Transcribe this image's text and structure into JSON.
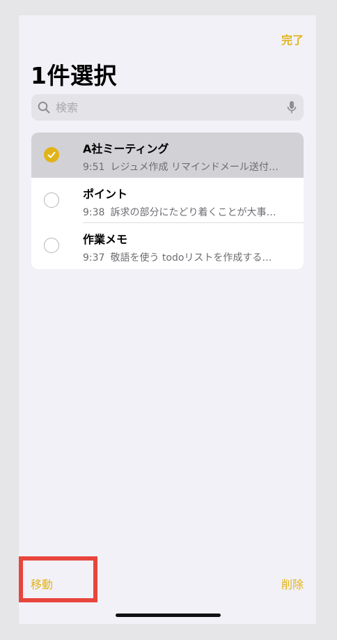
{
  "header": {
    "done_label": "完了",
    "title": "1件選択"
  },
  "search": {
    "placeholder": "検索"
  },
  "notes": [
    {
      "title": "A社ミーティング",
      "time": "9:51",
      "preview": "レジュメ作成 リマインドメール送付…",
      "selected": true
    },
    {
      "title": "ポイント",
      "time": "9:38",
      "preview": "訴求の部分にたどり着くことが大事…",
      "selected": false
    },
    {
      "title": "作業メモ",
      "time": "9:37",
      "preview": "敬語を使う todoリストを作成する…",
      "selected": false
    }
  ],
  "toolbar": {
    "move_label": "移動",
    "delete_label": "削除"
  },
  "colors": {
    "accent": "#e2b318",
    "highlight_box": "#e8453c"
  }
}
